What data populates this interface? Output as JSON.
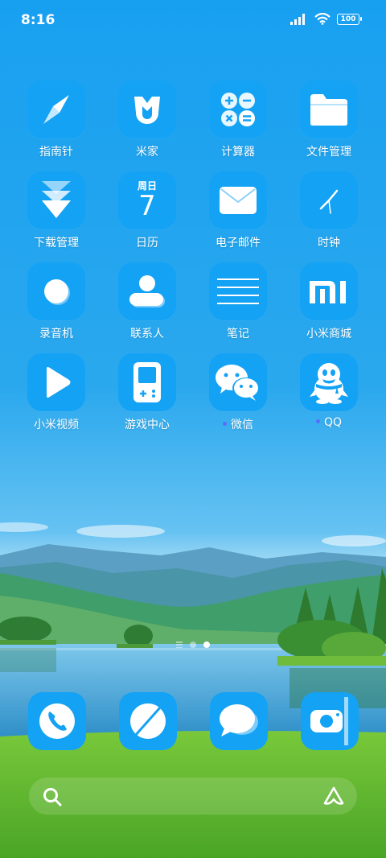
{
  "status_bar": {
    "time": "8:16",
    "battery": "100"
  },
  "apps": [
    {
      "label": "指南针",
      "icon": "compass-icon"
    },
    {
      "label": "米家",
      "icon": "mijia-icon"
    },
    {
      "label": "计算器",
      "icon": "calculator-icon"
    },
    {
      "label": "文件管理",
      "icon": "folder-icon"
    },
    {
      "label": "下载管理",
      "icon": "download-icon"
    },
    {
      "label": "日历",
      "icon": "calendar-icon",
      "weekday": "周日",
      "date": "7"
    },
    {
      "label": "电子邮件",
      "icon": "mail-icon"
    },
    {
      "label": "时钟",
      "icon": "clock-icon"
    },
    {
      "label": "录音机",
      "icon": "recorder-icon"
    },
    {
      "label": "联系人",
      "icon": "contacts-icon"
    },
    {
      "label": "笔记",
      "icon": "notes-icon"
    },
    {
      "label": "小米商城",
      "icon": "mi-store-icon"
    },
    {
      "label": "小米视频",
      "icon": "video-play-icon"
    },
    {
      "label": "游戏中心",
      "icon": "game-center-icon"
    },
    {
      "label": "微信",
      "icon": "wechat-icon",
      "notification_dot": true
    },
    {
      "label": "QQ",
      "icon": "qq-penguin-icon",
      "notification_dot": true
    }
  ],
  "pager": {
    "pages": 2,
    "current": 2
  },
  "dock": [
    {
      "icon": "phone-icon"
    },
    {
      "icon": "browser-icon"
    },
    {
      "icon": "messages-icon"
    },
    {
      "icon": "camera-icon"
    }
  ],
  "colors": {
    "icon_tile": "#14a2f5",
    "sky": "#1aa0ef",
    "notification_dot": "#5a6cff"
  }
}
